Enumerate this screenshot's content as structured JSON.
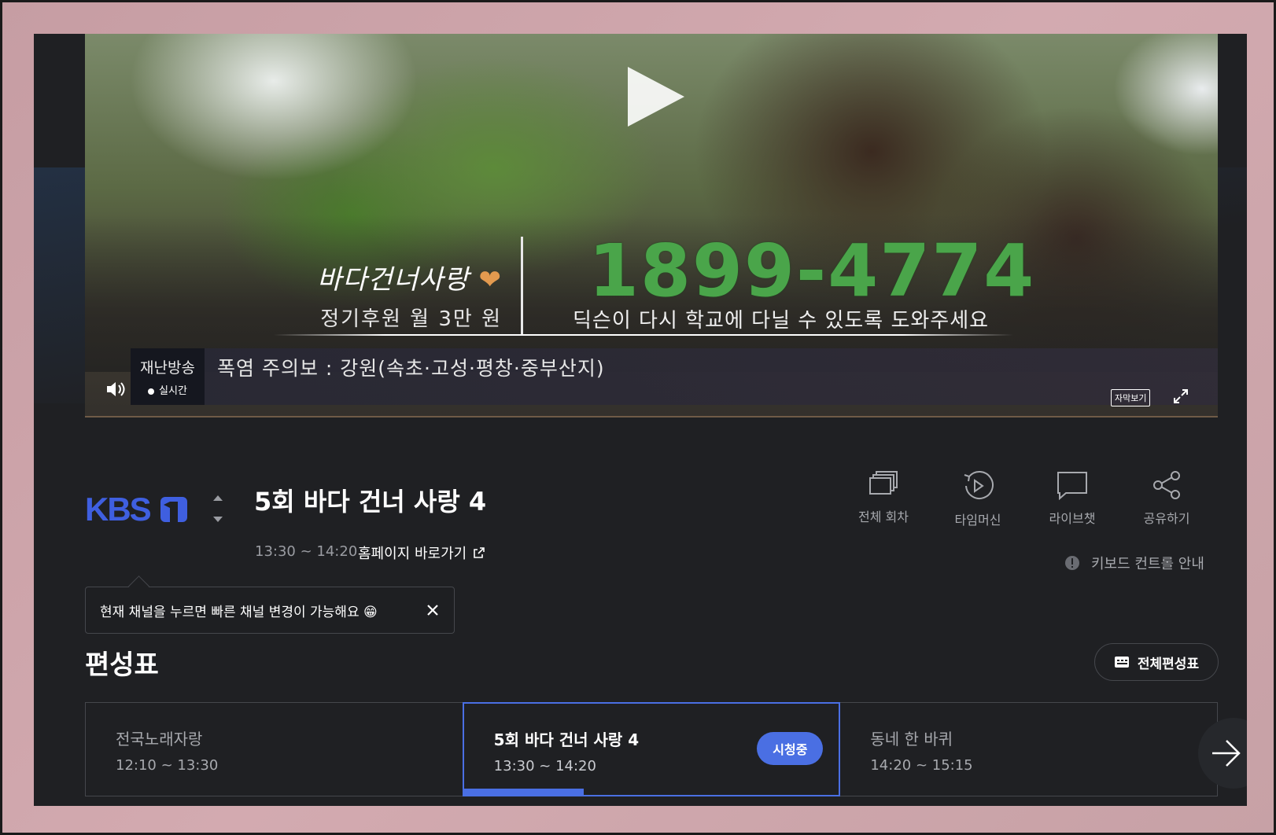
{
  "player": {
    "caption_script": "바다건너사랑",
    "caption_sub": "정기후원 월 3만 원",
    "phone_number": "1899-4774",
    "phone_desc": "딕슨이 다시 학교에 다닐 수 있도록 도와주세요",
    "ticker_badge": "재난방송",
    "ticker_live": "실시간",
    "ticker_text": "폭염 주의보 : 강원(속초·고성·평창·중부산지)",
    "subtitle_label": "자막보기"
  },
  "program": {
    "channel": "KBS1",
    "title": "5회 바다 건너 사랑 4",
    "time": "13:30 ~ 14:20",
    "homepage_link": "홈페이지 바로가기"
  },
  "actions": [
    {
      "label": "전체 회차",
      "icon": "episodes-icon"
    },
    {
      "label": "타임머신",
      "icon": "timemachine-icon"
    },
    {
      "label": "라이브챗",
      "icon": "chat-icon"
    },
    {
      "label": "공유하기",
      "icon": "share-icon"
    }
  ],
  "keyboard_guide": "키보드 컨트롤 안내",
  "tooltip": {
    "text": "현재 채널을 누르면 빠른 채널 변경이 가능해요 😁"
  },
  "schedule": {
    "title": "편성표",
    "full_button": "전체편성표",
    "items": [
      {
        "name": "전국노래자랑",
        "time": "12:10 ~ 13:30"
      },
      {
        "name": "5회 바다 건너 사랑 4",
        "time": "13:30 ~ 14:20",
        "badge": "시청중",
        "progress": 0.32
      },
      {
        "name": "동네 한 바퀴",
        "time": "14:20 ~ 15:15"
      }
    ]
  },
  "colors": {
    "accent": "#4a6fe3",
    "logo_blue": "#3f5fe0",
    "phone_green": "#4aa54a",
    "background": "#1f2023"
  }
}
